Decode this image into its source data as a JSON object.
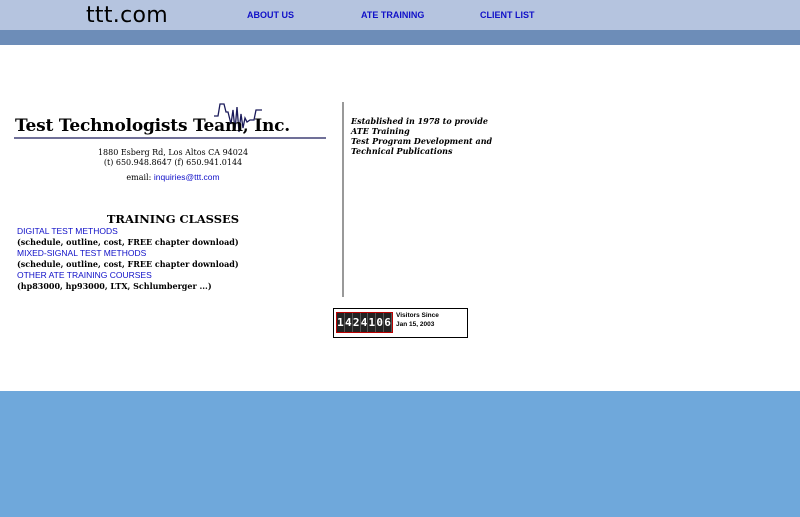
{
  "header": {
    "site_title": "ttt.com",
    "nav": [
      {
        "label": "ABOUT US"
      },
      {
        "label": "ATE TRAINING"
      },
      {
        "label": "CLIENT LIST"
      }
    ]
  },
  "company": {
    "logo_name": "Test Technologists Team, Inc.",
    "address": "1880 Esberg Rd, Los Altos CA 94024",
    "phone": "(t) 650.948.8647 (f) 650.941.0144",
    "email_label": "email: ",
    "email": "inquiries@ttt.com"
  },
  "training": {
    "title": "TRAINING CLASSES",
    "courses": [
      {
        "link": "DIGITAL TEST METHODS",
        "desc": "(schedule, outline, cost, FREE chapter download)"
      },
      {
        "link": "MIXED-SIGNAL TEST METHODS",
        "desc": "(schedule, outline, cost, FREE chapter download)"
      },
      {
        "link": "OTHER ATE TRAINING COURSES",
        "desc": "(hp83000, hp93000, LTX, Schlumberger ...)"
      }
    ]
  },
  "about": {
    "lines": [
      "Established in 1978 to provide",
      "ATE Training",
      "Test Program Development and",
      "Technical Publications"
    ]
  },
  "counter": {
    "digits": [
      "1",
      "4",
      "2",
      "4",
      "1",
      "0",
      "6"
    ],
    "label_line1": "Visitors Since",
    "label_line2": "Jan 15, 2003"
  },
  "colors": {
    "link": "#1010c8",
    "header_bar": "#b5c4df",
    "header_strip": "#6d8db8",
    "page_bg": "#6fa8db"
  }
}
